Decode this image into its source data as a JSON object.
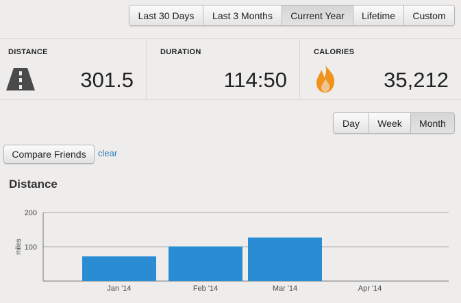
{
  "range_tabs": [
    "Last 30 Days",
    "Last 3 Months",
    "Current Year",
    "Lifetime",
    "Custom"
  ],
  "range_active": "Current Year",
  "stats": {
    "distance": {
      "label": "DISTANCE",
      "value": "301.5"
    },
    "duration": {
      "label": "DURATION",
      "value": "114:50"
    },
    "calories": {
      "label": "CALORIES",
      "value": "35,212"
    }
  },
  "granularity_tabs": [
    "Day",
    "Week",
    "Month"
  ],
  "granularity_active": "Month",
  "compare_button": "Compare Friends",
  "clear_link": "clear",
  "chart_title": "Distance",
  "colors": {
    "bar": "#2a8dd4",
    "link": "#2a7ab8",
    "flame": "#f0921c",
    "road": "#4a4a4a"
  },
  "icons": {
    "distance": "road-icon",
    "calories": "flame-icon"
  },
  "chart_data": {
    "type": "bar",
    "title": "Distance",
    "xlabel": "",
    "ylabel": "miles",
    "categories": [
      "Jan '14",
      "Feb '14",
      "Mar '14",
      "Apr '14"
    ],
    "values": [
      72,
      101,
      127,
      0
    ],
    "ylim": [
      0,
      200
    ],
    "yticks": [
      100,
      200
    ],
    "grid": true
  }
}
